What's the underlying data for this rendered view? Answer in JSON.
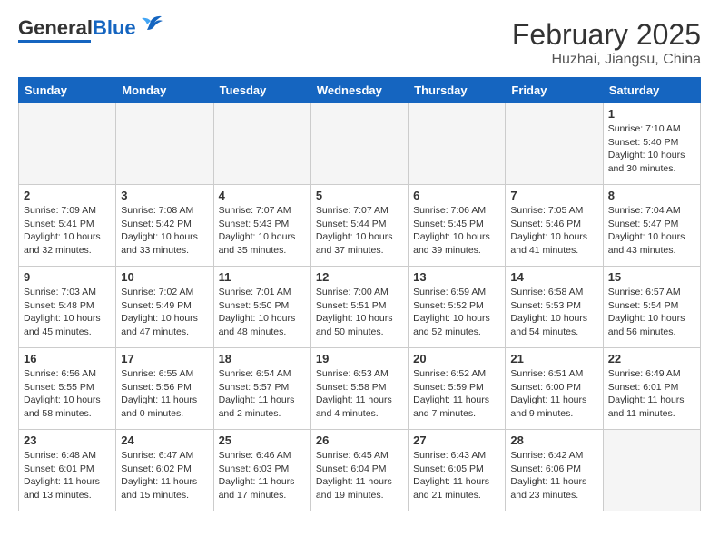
{
  "header": {
    "logo_general": "General",
    "logo_blue": "Blue",
    "month_title": "February 2025",
    "subtitle": "Huzhai, Jiangsu, China"
  },
  "days_of_week": [
    "Sunday",
    "Monday",
    "Tuesday",
    "Wednesday",
    "Thursday",
    "Friday",
    "Saturday"
  ],
  "weeks": [
    [
      {
        "day": "",
        "empty": true
      },
      {
        "day": "",
        "empty": true
      },
      {
        "day": "",
        "empty": true
      },
      {
        "day": "",
        "empty": true
      },
      {
        "day": "",
        "empty": true
      },
      {
        "day": "",
        "empty": true
      },
      {
        "day": "1",
        "info": "Sunrise: 7:10 AM\nSunset: 5:40 PM\nDaylight: 10 hours\nand 30 minutes."
      }
    ],
    [
      {
        "day": "2",
        "info": "Sunrise: 7:09 AM\nSunset: 5:41 PM\nDaylight: 10 hours\nand 32 minutes."
      },
      {
        "day": "3",
        "info": "Sunrise: 7:08 AM\nSunset: 5:42 PM\nDaylight: 10 hours\nand 33 minutes."
      },
      {
        "day": "4",
        "info": "Sunrise: 7:07 AM\nSunset: 5:43 PM\nDaylight: 10 hours\nand 35 minutes."
      },
      {
        "day": "5",
        "info": "Sunrise: 7:07 AM\nSunset: 5:44 PM\nDaylight: 10 hours\nand 37 minutes."
      },
      {
        "day": "6",
        "info": "Sunrise: 7:06 AM\nSunset: 5:45 PM\nDaylight: 10 hours\nand 39 minutes."
      },
      {
        "day": "7",
        "info": "Sunrise: 7:05 AM\nSunset: 5:46 PM\nDaylight: 10 hours\nand 41 minutes."
      },
      {
        "day": "8",
        "info": "Sunrise: 7:04 AM\nSunset: 5:47 PM\nDaylight: 10 hours\nand 43 minutes."
      }
    ],
    [
      {
        "day": "9",
        "info": "Sunrise: 7:03 AM\nSunset: 5:48 PM\nDaylight: 10 hours\nand 45 minutes."
      },
      {
        "day": "10",
        "info": "Sunrise: 7:02 AM\nSunset: 5:49 PM\nDaylight: 10 hours\nand 47 minutes."
      },
      {
        "day": "11",
        "info": "Sunrise: 7:01 AM\nSunset: 5:50 PM\nDaylight: 10 hours\nand 48 minutes."
      },
      {
        "day": "12",
        "info": "Sunrise: 7:00 AM\nSunset: 5:51 PM\nDaylight: 10 hours\nand 50 minutes."
      },
      {
        "day": "13",
        "info": "Sunrise: 6:59 AM\nSunset: 5:52 PM\nDaylight: 10 hours\nand 52 minutes."
      },
      {
        "day": "14",
        "info": "Sunrise: 6:58 AM\nSunset: 5:53 PM\nDaylight: 10 hours\nand 54 minutes."
      },
      {
        "day": "15",
        "info": "Sunrise: 6:57 AM\nSunset: 5:54 PM\nDaylight: 10 hours\nand 56 minutes."
      }
    ],
    [
      {
        "day": "16",
        "info": "Sunrise: 6:56 AM\nSunset: 5:55 PM\nDaylight: 10 hours\nand 58 minutes."
      },
      {
        "day": "17",
        "info": "Sunrise: 6:55 AM\nSunset: 5:56 PM\nDaylight: 11 hours\nand 0 minutes."
      },
      {
        "day": "18",
        "info": "Sunrise: 6:54 AM\nSunset: 5:57 PM\nDaylight: 11 hours\nand 2 minutes."
      },
      {
        "day": "19",
        "info": "Sunrise: 6:53 AM\nSunset: 5:58 PM\nDaylight: 11 hours\nand 4 minutes."
      },
      {
        "day": "20",
        "info": "Sunrise: 6:52 AM\nSunset: 5:59 PM\nDaylight: 11 hours\nand 7 minutes."
      },
      {
        "day": "21",
        "info": "Sunrise: 6:51 AM\nSunset: 6:00 PM\nDaylight: 11 hours\nand 9 minutes."
      },
      {
        "day": "22",
        "info": "Sunrise: 6:49 AM\nSunset: 6:01 PM\nDaylight: 11 hours\nand 11 minutes."
      }
    ],
    [
      {
        "day": "23",
        "info": "Sunrise: 6:48 AM\nSunset: 6:01 PM\nDaylight: 11 hours\nand 13 minutes."
      },
      {
        "day": "24",
        "info": "Sunrise: 6:47 AM\nSunset: 6:02 PM\nDaylight: 11 hours\nand 15 minutes."
      },
      {
        "day": "25",
        "info": "Sunrise: 6:46 AM\nSunset: 6:03 PM\nDaylight: 11 hours\nand 17 minutes."
      },
      {
        "day": "26",
        "info": "Sunrise: 6:45 AM\nSunset: 6:04 PM\nDaylight: 11 hours\nand 19 minutes."
      },
      {
        "day": "27",
        "info": "Sunrise: 6:43 AM\nSunset: 6:05 PM\nDaylight: 11 hours\nand 21 minutes."
      },
      {
        "day": "28",
        "info": "Sunrise: 6:42 AM\nSunset: 6:06 PM\nDaylight: 11 hours\nand 23 minutes."
      },
      {
        "day": "",
        "empty": true
      }
    ]
  ]
}
